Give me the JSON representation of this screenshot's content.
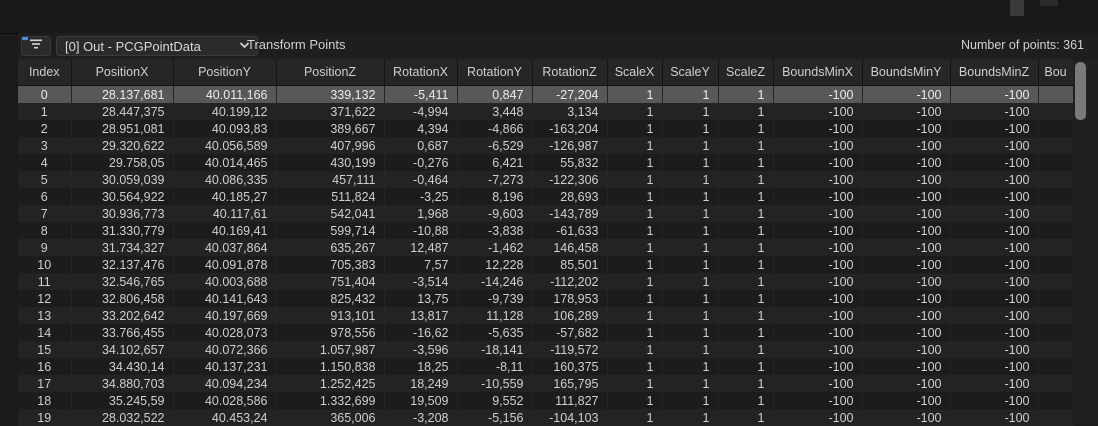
{
  "toolbar": {
    "pin_label": "[0] Out - PCGPointData",
    "node_label": "Transform Points",
    "points_count": "Number of points: 361"
  },
  "table": {
    "columns": [
      "Index",
      "PositionX",
      "PositionY",
      "PositionZ",
      "RotationX",
      "RotationY",
      "RotationZ",
      "ScaleX",
      "ScaleY",
      "ScaleZ",
      "BoundsMinX",
      "BoundsMinY",
      "BoundsMinZ",
      "Bou"
    ],
    "selected_index": 0,
    "rows": [
      [
        "0",
        "28.137,681",
        "40.011,166",
        "339,132",
        "-5,411",
        "0,847",
        "-27,204",
        "1",
        "1",
        "1",
        "-100",
        "-100",
        "-100",
        ""
      ],
      [
        "1",
        "28.447,375",
        "40.199,12",
        "371,622",
        "-4,994",
        "3,448",
        "3,134",
        "1",
        "1",
        "1",
        "-100",
        "-100",
        "-100",
        ""
      ],
      [
        "2",
        "28.951,081",
        "40.093,83",
        "389,667",
        "4,394",
        "-4,866",
        "-163,204",
        "1",
        "1",
        "1",
        "-100",
        "-100",
        "-100",
        ""
      ],
      [
        "3",
        "29.320,622",
        "40.056,589",
        "407,996",
        "0,687",
        "-6,529",
        "-126,987",
        "1",
        "1",
        "1",
        "-100",
        "-100",
        "-100",
        ""
      ],
      [
        "4",
        "29.758,05",
        "40.014,465",
        "430,199",
        "-0,276",
        "6,421",
        "55,832",
        "1",
        "1",
        "1",
        "-100",
        "-100",
        "-100",
        ""
      ],
      [
        "5",
        "30.059,039",
        "40.086,335",
        "457,111",
        "-0,464",
        "-7,273",
        "-122,306",
        "1",
        "1",
        "1",
        "-100",
        "-100",
        "-100",
        ""
      ],
      [
        "6",
        "30.564,922",
        "40.185,27",
        "511,824",
        "-3,25",
        "8,196",
        "28,693",
        "1",
        "1",
        "1",
        "-100",
        "-100",
        "-100",
        ""
      ],
      [
        "7",
        "30.936,773",
        "40.117,61",
        "542,041",
        "1,968",
        "-9,603",
        "-143,789",
        "1",
        "1",
        "1",
        "-100",
        "-100",
        "-100",
        ""
      ],
      [
        "8",
        "31.330,779",
        "40.169,41",
        "599,714",
        "-10,88",
        "-3,838",
        "-61,633",
        "1",
        "1",
        "1",
        "-100",
        "-100",
        "-100",
        ""
      ],
      [
        "9",
        "31.734,327",
        "40.037,864",
        "635,267",
        "12,487",
        "-1,462",
        "146,458",
        "1",
        "1",
        "1",
        "-100",
        "-100",
        "-100",
        ""
      ],
      [
        "10",
        "32.137,476",
        "40.091,878",
        "705,383",
        "7,57",
        "12,228",
        "85,501",
        "1",
        "1",
        "1",
        "-100",
        "-100",
        "-100",
        ""
      ],
      [
        "11",
        "32.546,765",
        "40.003,688",
        "751,404",
        "-3,514",
        "-14,246",
        "-112,202",
        "1",
        "1",
        "1",
        "-100",
        "-100",
        "-100",
        ""
      ],
      [
        "12",
        "32.806,458",
        "40.141,643",
        "825,432",
        "13,75",
        "-9,739",
        "178,953",
        "1",
        "1",
        "1",
        "-100",
        "-100",
        "-100",
        ""
      ],
      [
        "13",
        "33.202,642",
        "40.197,669",
        "913,101",
        "13,817",
        "11,128",
        "106,289",
        "1",
        "1",
        "1",
        "-100",
        "-100",
        "-100",
        ""
      ],
      [
        "14",
        "33.766,455",
        "40.028,073",
        "978,556",
        "-16,62",
        "-5,635",
        "-57,682",
        "1",
        "1",
        "1",
        "-100",
        "-100",
        "-100",
        ""
      ],
      [
        "15",
        "34.102,657",
        "40.072,366",
        "1.057,987",
        "-3,596",
        "-18,141",
        "-119,572",
        "1",
        "1",
        "1",
        "-100",
        "-100",
        "-100",
        ""
      ],
      [
        "16",
        "34.430,14",
        "40.137,231",
        "1.150,838",
        "18,25",
        "-8,11",
        "160,375",
        "1",
        "1",
        "1",
        "-100",
        "-100",
        "-100",
        ""
      ],
      [
        "17",
        "34.880,703",
        "40.094,234",
        "1.252,425",
        "18,249",
        "-10,559",
        "165,795",
        "1",
        "1",
        "1",
        "-100",
        "-100",
        "-100",
        ""
      ],
      [
        "18",
        "35.245,59",
        "40.028,586",
        "1.332,699",
        "19,509",
        "9,552",
        "111,827",
        "1",
        "1",
        "1",
        "-100",
        "-100",
        "-100",
        ""
      ],
      [
        "19",
        "28.032,522",
        "40.453,24",
        "365,006",
        "-3,208",
        "-5,156",
        "-104,103",
        "1",
        "1",
        "1",
        "-100",
        "-100",
        "-100",
        ""
      ]
    ]
  }
}
